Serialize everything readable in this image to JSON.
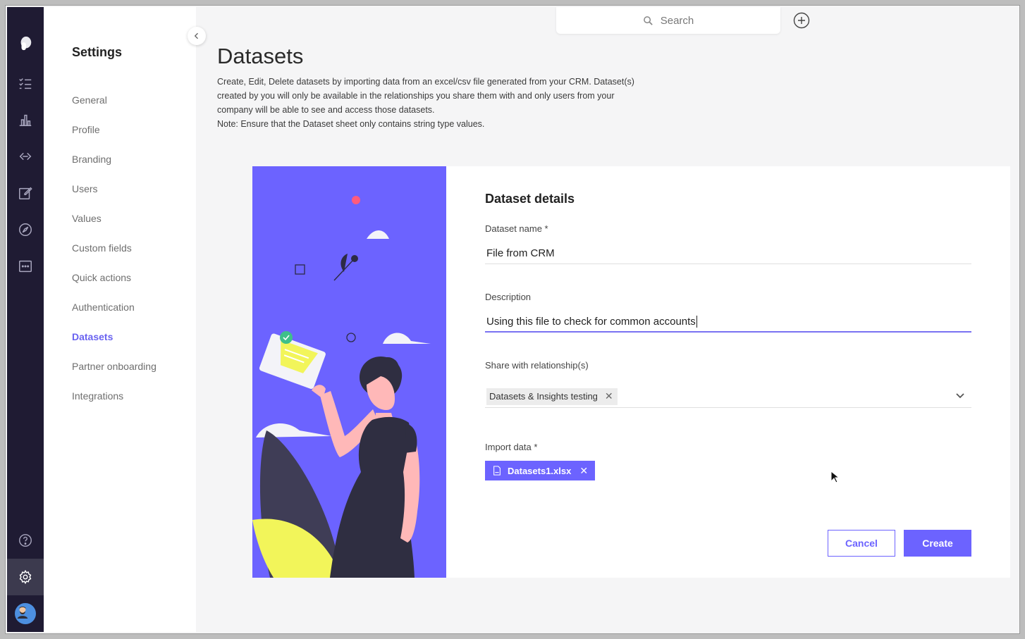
{
  "search": {
    "placeholder": "Search"
  },
  "settings": {
    "title": "Settings",
    "items": [
      {
        "label": "General"
      },
      {
        "label": "Profile"
      },
      {
        "label": "Branding"
      },
      {
        "label": "Users"
      },
      {
        "label": "Values"
      },
      {
        "label": "Custom fields"
      },
      {
        "label": "Quick actions"
      },
      {
        "label": "Authentication"
      },
      {
        "label": "Datasets",
        "active": true
      },
      {
        "label": "Partner onboarding"
      },
      {
        "label": "Integrations"
      }
    ]
  },
  "page": {
    "title": "Datasets",
    "description_lines": [
      "Create, Edit, Delete datasets by importing data from an excel/csv file generated from your CRM. Dataset(s)",
      "created by you will only be available in the relationships you share them with and only users from your",
      "company will be able to see and access those datasets.",
      "Note: Ensure that the Dataset sheet only contains string type values."
    ]
  },
  "form": {
    "heading": "Dataset details",
    "name_label": "Dataset name *",
    "name_value": "File from CRM",
    "description_label": "Description",
    "description_value": "Using this file to check for common accounts",
    "share_label": "Share with relationship(s)",
    "share_chip": "Datasets & Insights testing",
    "import_label": "Import data *",
    "file_name": "Datasets1.xlsx",
    "cancel_label": "Cancel",
    "create_label": "Create"
  },
  "colors": {
    "accent": "#6c63ff",
    "rail": "#1f1b33",
    "illustration_accent": "#f2f55a"
  },
  "icons": [
    "logo-icon",
    "checklist-icon",
    "bar-chart-icon",
    "link-icon",
    "edit-icon",
    "compass-icon",
    "chat-icon",
    "help-icon",
    "gear-icon",
    "search-icon",
    "plus-circle-icon",
    "chevron-left-icon",
    "chevron-down-icon",
    "close-icon",
    "csv-file-icon"
  ]
}
